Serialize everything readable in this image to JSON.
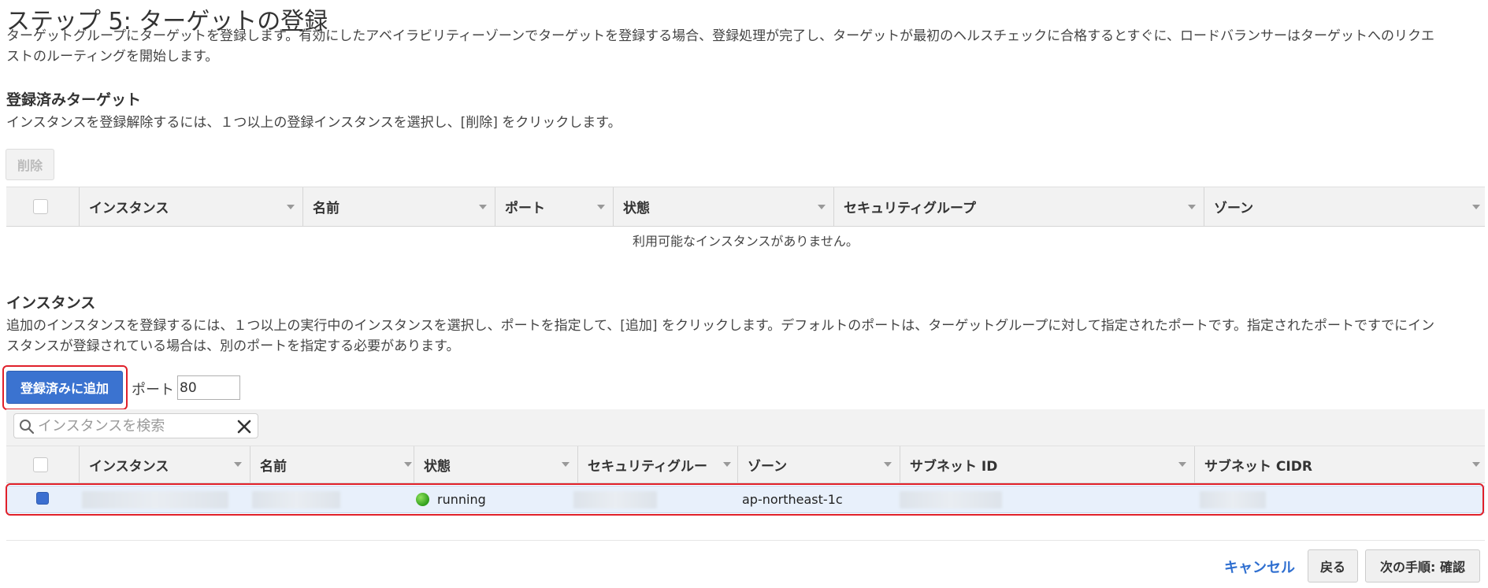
{
  "page": {
    "title": "ステップ 5: ターゲットの登録",
    "description_line1": "ターゲットグループにターゲットを登録します。有効にしたアベイラビリティーゾーンでターゲットを登録する場合、登録処理が完了し、ターゲットが最初のヘルスチェックに合格するとすぐに、ロードバランサーはターゲットへのリクエ",
    "description_line2": "ストのルーティングを開始します。"
  },
  "registered": {
    "title": "登録済みターゲット",
    "description": "インスタンスを登録解除するには、１つ以上の登録インスタンスを選択し、[削除] をクリックします。",
    "remove_button": "削除",
    "columns": [
      "インスタンス",
      "名前",
      "ポート",
      "状態",
      "セキュリティグループ",
      "ゾーン"
    ],
    "empty_message": "利用可能なインスタンスがありません。"
  },
  "instances": {
    "title": "インスタンス",
    "description_line1": "追加のインスタンスを登録するには、１つ以上の実行中のインスタンスを選択し、ポートを指定して、[追加] をクリックします。デフォルトのポートは、ターゲットグループに対して指定されたポートです。指定されたポートですでにイン",
    "description_line2": "スタンスが登録されている場合は、別のポートを指定する必要があります。",
    "add_button": "登録済みに追加",
    "port_label": "ポート",
    "port_value": "80",
    "search_placeholder": "インスタンスを検索",
    "columns": [
      "インスタンス",
      "名前",
      "状態",
      "セキュリティグルー",
      "ゾーン",
      "サブネット ID",
      "サブネット CIDR"
    ],
    "rows": [
      {
        "selected": true,
        "state": "running",
        "zone": "ap-northeast-1c"
      }
    ]
  },
  "footer": {
    "cancel": "キャンセル",
    "back": "戻る",
    "next": "次の手順: 確認"
  },
  "icons": {
    "search": "search-icon",
    "clear": "close-icon",
    "sort": "chevron-down-icon",
    "status": "status-running-icon"
  },
  "colors": {
    "primary": "#3b73d0",
    "link": "#2f6fd0",
    "highlight": "#e0202a",
    "running": "#2f9e1c"
  }
}
